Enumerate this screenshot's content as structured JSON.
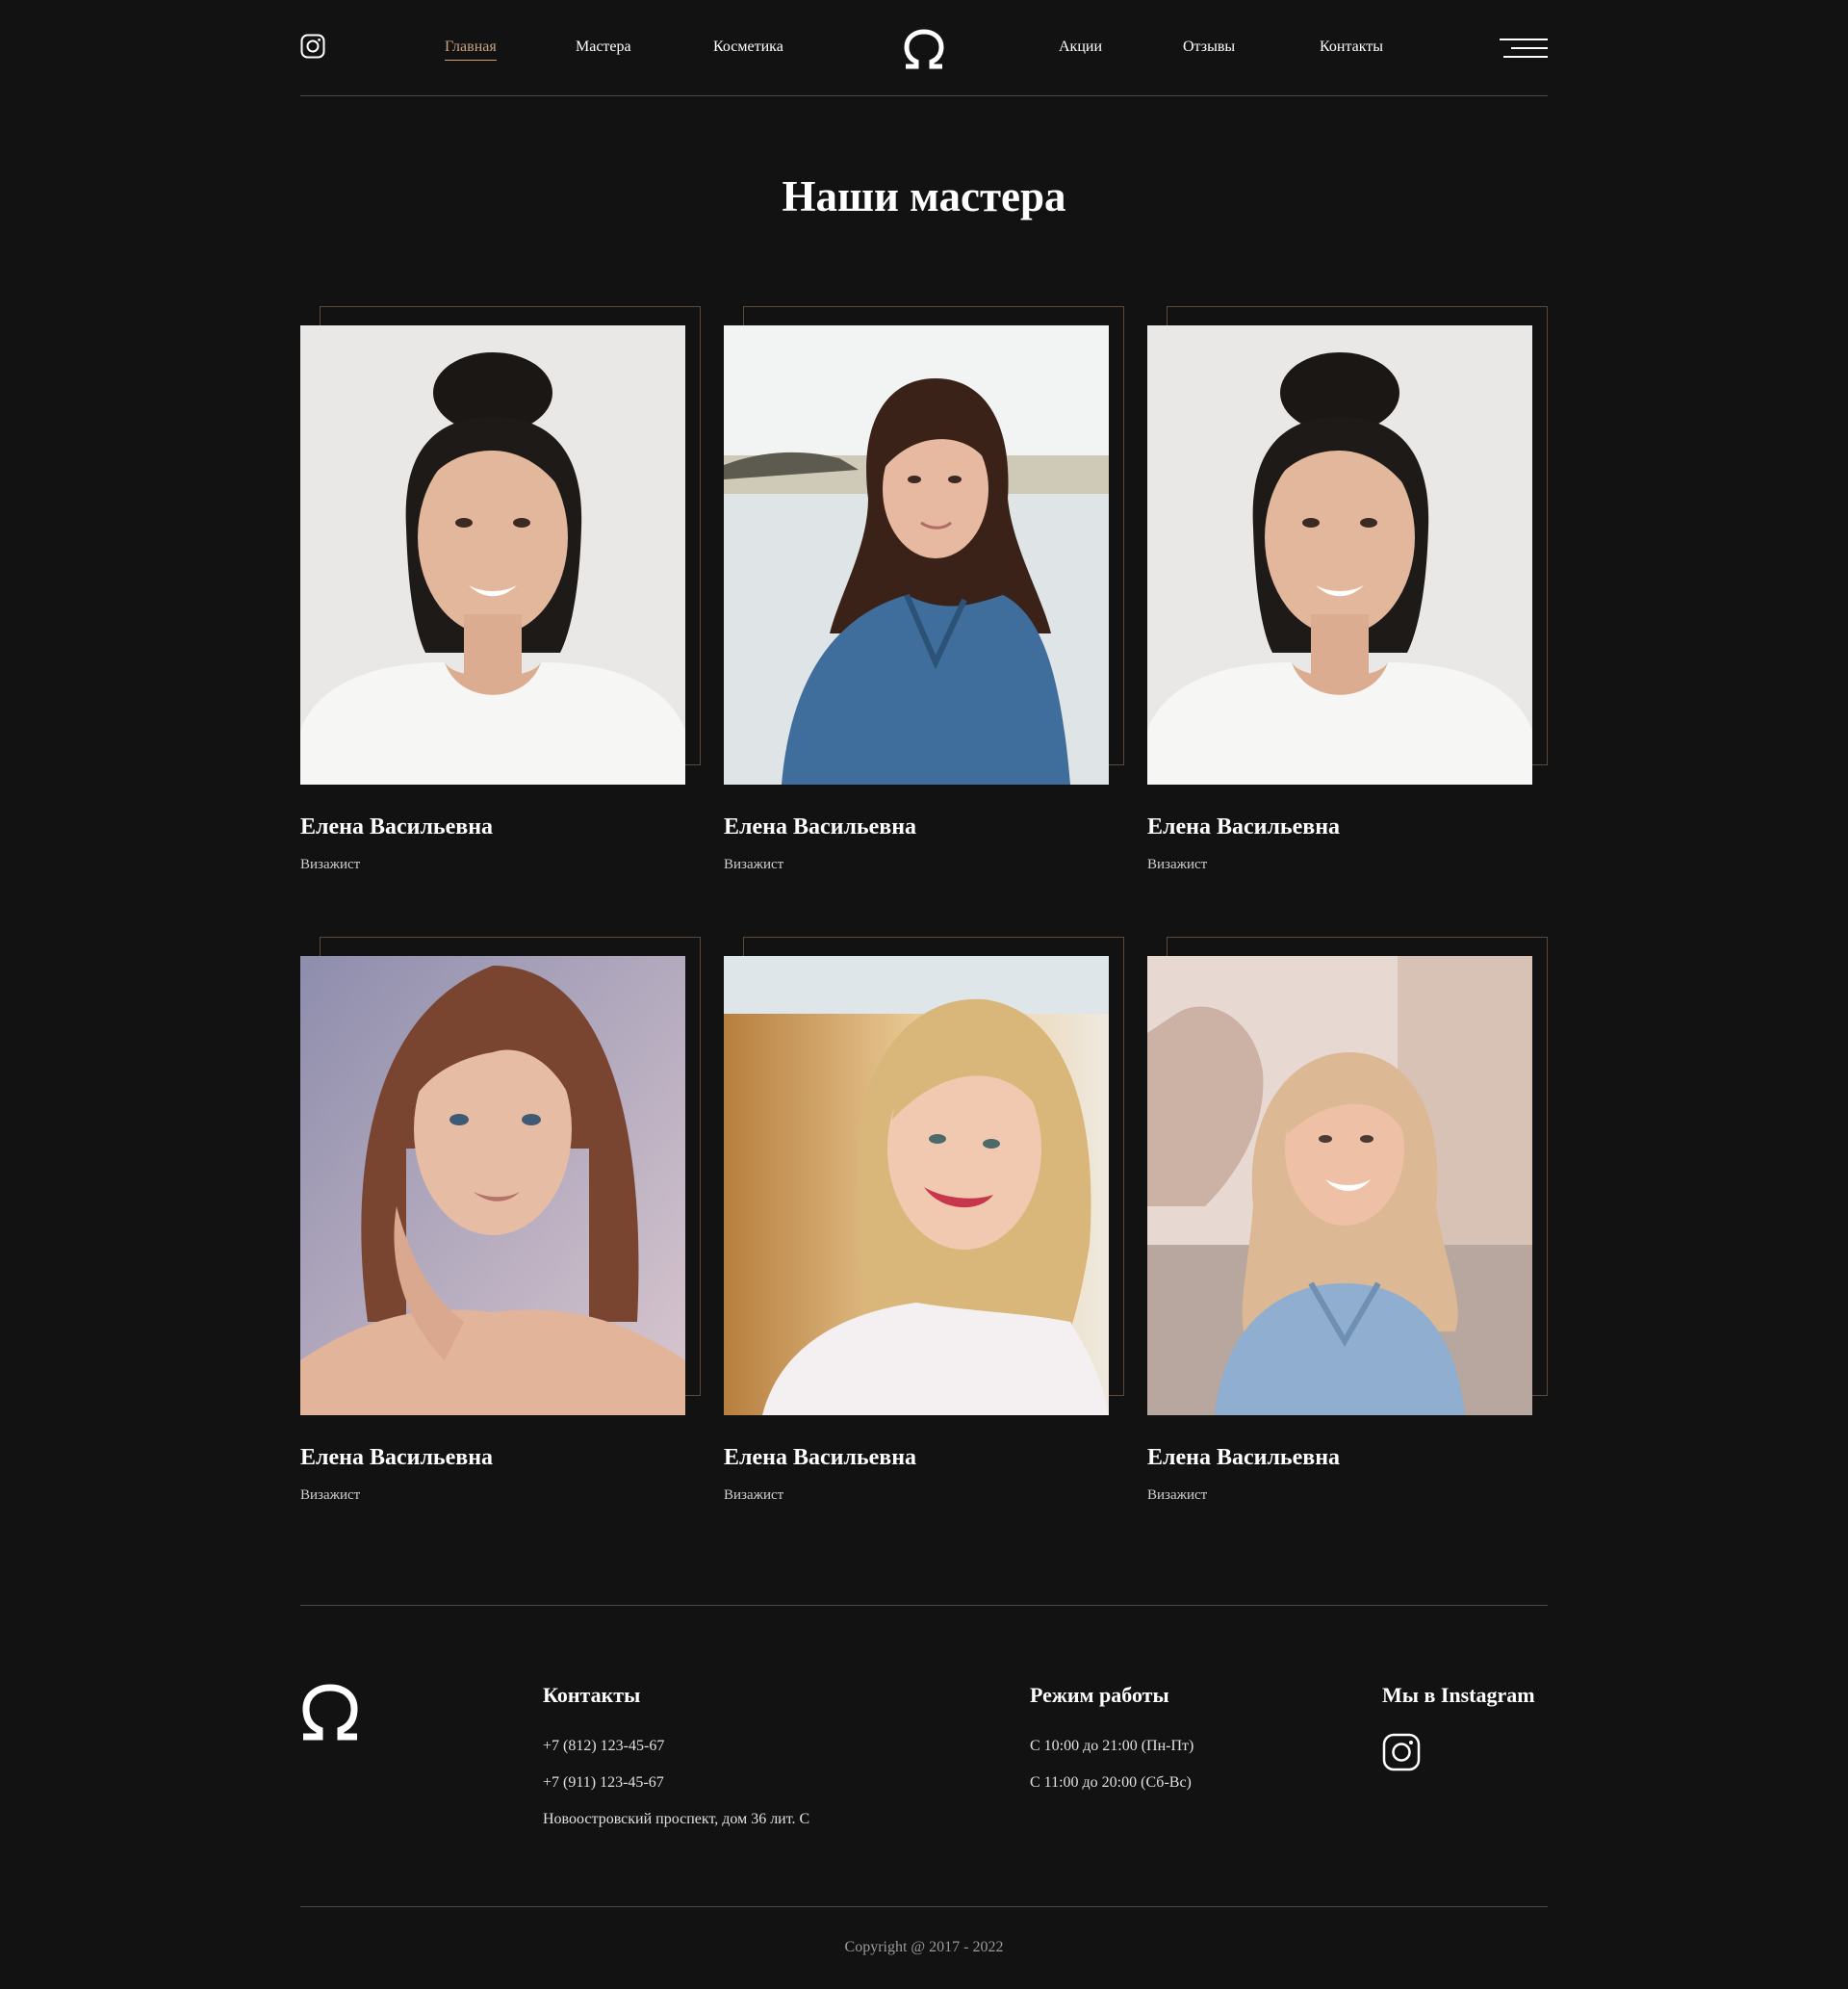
{
  "header": {
    "nav_left": [
      "Главная",
      "Мастера",
      "Косметика"
    ],
    "nav_right": [
      "Акции",
      "Отзывы",
      "Контакты"
    ],
    "active_index": 0,
    "accent_color": "#c9a27e",
    "icons": [
      "instagram-icon",
      "omega-logo",
      "menu-icon"
    ]
  },
  "page": {
    "title": "Наши мастера"
  },
  "masters": [
    {
      "name": "Елена Васильевна",
      "role": "Визажист"
    },
    {
      "name": "Елена Васильевна",
      "role": "Визажист"
    },
    {
      "name": "Елена Васильевна",
      "role": "Визажист"
    },
    {
      "name": "Елена Васильевна",
      "role": "Визажист"
    },
    {
      "name": "Елена Васильевна",
      "role": "Визажист"
    },
    {
      "name": "Елена Васильевна",
      "role": "Визажист"
    }
  ],
  "footer": {
    "contacts_heading": "Контакты",
    "phone1": "+7 (812) 123-45-67",
    "phone2": "+7 (911) 123-45-67",
    "address": "Новоостровский проспект, дом 36 лит. С",
    "hours_heading": "Режим работы",
    "hours1": "С 10:00 до 21:00 (Пн-Пт)",
    "hours2": "С 11:00 до 20:00 (Сб-Вс)",
    "instagram_heading": "Мы в Instagram",
    "copyright": "Copyright @ 2017 - 2022"
  },
  "colors": {
    "background": "#121212",
    "frame": "#5a4a3a",
    "divider": "#4a4a4a"
  }
}
